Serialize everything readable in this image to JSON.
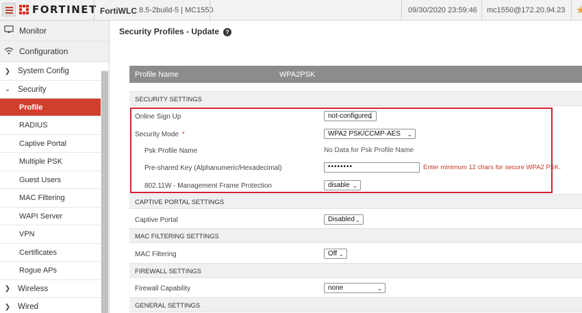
{
  "topbar": {
    "logo_text": "FORTINET",
    "product": "FortiWLC",
    "version": "8.5-2build-5 | MC1550",
    "datetime": "09/30/2020 23:59:46",
    "user_host": "mc1550@172.20.94.23"
  },
  "sidebar": {
    "monitor": "Monitor",
    "configuration": "Configuration",
    "system_config": "System Config",
    "security": "Security",
    "items": [
      "Profile",
      "RADIUS",
      "Captive Portal",
      "Multiple PSK",
      "Guest Users",
      "MAC Filtering",
      "WAPI Server",
      "VPN",
      "Certificates",
      "Rogue APs"
    ],
    "wireless": "Wireless",
    "wired": "Wired"
  },
  "page": {
    "title": "Security Profiles - Update"
  },
  "profile": {
    "label": "Profile Name",
    "value": "WPA2PSK"
  },
  "sections": {
    "security": "SECURITY SETTINGS",
    "captive": "CAPTIVE PORTAL SETTINGS",
    "mac": "MAC FILTERING SETTINGS",
    "firewall": "FIREWALL SETTINGS",
    "general": "GENERAL SETTINGS"
  },
  "fields": {
    "online_signup": {
      "label": "Online Sign Up",
      "value": "not-configured"
    },
    "security_mode": {
      "label": "Security Mode",
      "required": "*",
      "value": "WPA2 PSK/CCMP-AES"
    },
    "psk_profile": {
      "label": "Psk Profile Name",
      "value": "No Data for Psk Profile Name"
    },
    "preshared_key": {
      "label": "Pre-shared Key (Alphanumeric/Hexadecimal)",
      "value": "••••••••",
      "error": "Enter minimum 12 chars for secure WPA2 PSK."
    },
    "mfp": {
      "label": "802.11W - Management Frame Protection",
      "value": "disable"
    },
    "captive_portal": {
      "label": "Captive Portal",
      "value": "Disabled"
    },
    "mac_filtering": {
      "label": "MAC Filtering",
      "value": "Off"
    },
    "firewall": {
      "label": "Firewall Capability",
      "value": "none"
    }
  },
  "colors": {
    "accent": "#d0402c",
    "highlight_border": "#d3202e",
    "header_band": "#8c8c8c"
  }
}
